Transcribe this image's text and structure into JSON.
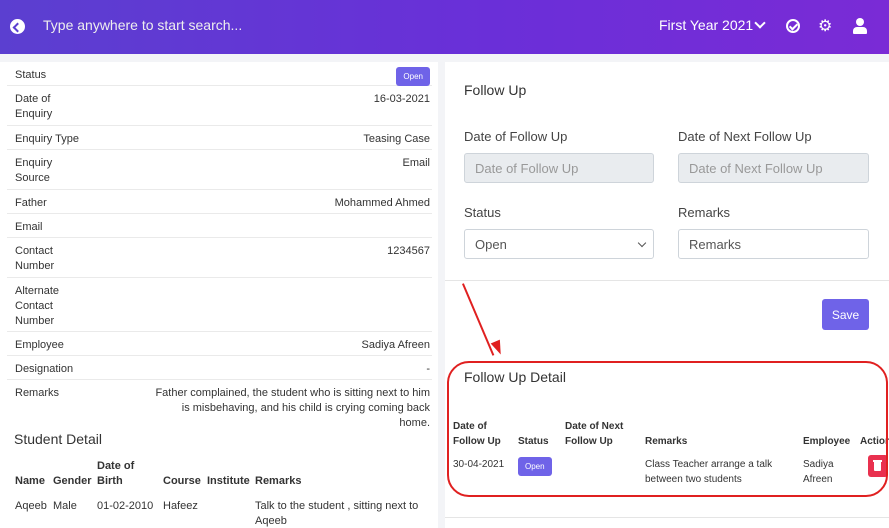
{
  "header": {
    "search_placeholder": "Type anywhere to start search...",
    "year": "First Year 2021"
  },
  "enquiry": {
    "status_label": "Status",
    "status_value": "Open",
    "date_label": "Date of Enquiry",
    "date_value": "16-03-2021",
    "type_label": "Enquiry Type",
    "type_value": "Teasing Case",
    "source_label": "Enquiry Source",
    "source_value": "Email",
    "father_label": "Father",
    "father_value": "Mohammed Ahmed",
    "email_label": "Email",
    "contact_label": "Contact Number",
    "contact_value": "1234567",
    "alt_contact_label": "Alternate Contact Number",
    "employee_label": "Employee",
    "employee_value": "Sadiya Afreen",
    "designation_label": "Designation",
    "designation_value": "-",
    "remarks_label": "Remarks",
    "remarks_value": "Father complained, the student who is sitting next to him is misbehaving, and his child is crying coming back home."
  },
  "student_detail": {
    "title": "Student Detail",
    "headers": [
      "Name",
      "Gender",
      "Date of Birth",
      "Course",
      "Institute",
      "Remarks"
    ],
    "rows": [
      {
        "name": "Aqeeb",
        "gender": "Male",
        "dob": "01-02-2010",
        "course": "Hafeez",
        "institute": "",
        "remarks": "Talk to the student , sitting next to Aqeeb"
      }
    ]
  },
  "follow_up": {
    "title": "Follow Up",
    "date_label": "Date of Follow Up",
    "date_placeholder": "Date of Follow Up",
    "next_label": "Date of Next Follow Up",
    "next_placeholder": "Date of Next Follow Up",
    "status_label": "Status",
    "status_value": "Open",
    "remarks_label": "Remarks",
    "remarks_placeholder": "Remarks",
    "save_label": "Save"
  },
  "follow_up_detail": {
    "title": "Follow Up Detail",
    "headers": [
      "Date of Follow Up",
      "Status",
      "Date of Next Follow Up",
      "Remarks",
      "Employee",
      "Action"
    ],
    "rows": [
      {
        "date": "30-04-2021",
        "status": "Open",
        "next_date": "",
        "remarks": "Class Teacher arrange a talk between two students",
        "employee": "Sadiya Afreen"
      }
    ]
  },
  "colors": {
    "header_start": "#5b3fd0",
    "header_end": "#7a2bd6",
    "accent": "#6f63e8",
    "danger": "#e9314f",
    "annotation": "#e02020"
  }
}
